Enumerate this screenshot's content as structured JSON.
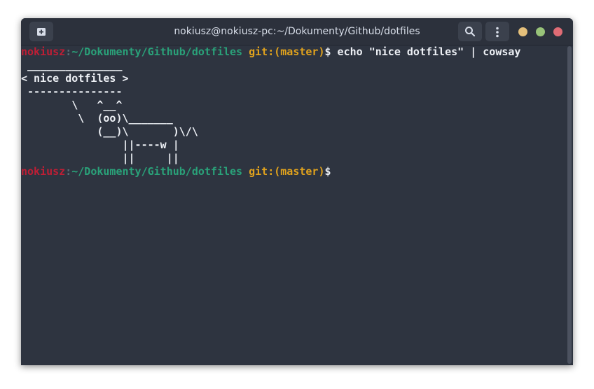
{
  "window": {
    "title": "nokiusz@nokiusz-pc:~/Dokumenty/Github/dotfiles",
    "controls": {
      "minimize_color": "#e5c07b",
      "maximize_color": "#98c379",
      "close_color": "#e06c75"
    },
    "icons": {
      "new_tab": "new-tab-icon",
      "search": "search-icon",
      "menu": "kebab-menu-icon"
    }
  },
  "prompt": {
    "user": "nokiusz",
    "separator": ":",
    "path": "~/Dokumenty/Github/dotfiles",
    "git": "git:(master)",
    "symbol": "$"
  },
  "terminal": {
    "command": " echo \"nice dotfiles\" | cowsay",
    "output": [
      " _______________",
      "< nice dotfiles >",
      " ---------------",
      "        \\   ^__^",
      "         \\  (oo)\\_______",
      "            (__)\\       )\\/\\",
      "                ||----w |",
      "                ||     ||"
    ]
  },
  "colors": {
    "background": "#2e3440",
    "user": "#bf1e35",
    "path": "#2aa179",
    "git": "#e0a21d",
    "text": "#eceff4"
  }
}
